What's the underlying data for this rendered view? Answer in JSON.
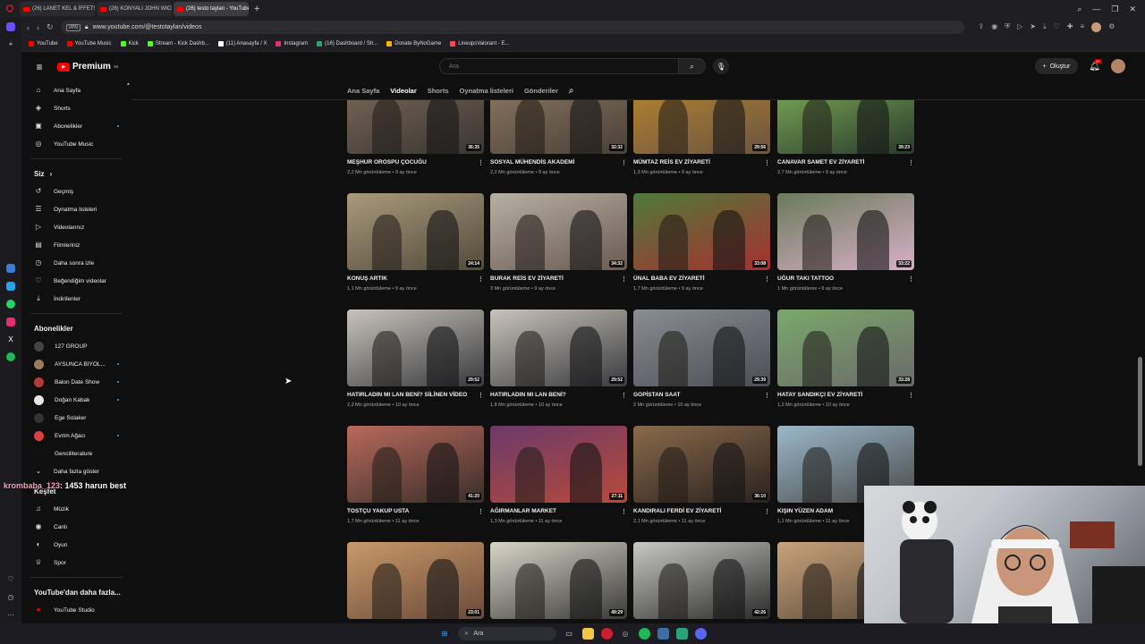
{
  "browser": {
    "tabs": [
      {
        "title": "(26) LANET KEL & İFFETSİZ",
        "active": false
      },
      {
        "title": "(26) KONYALI JOHN WICK",
        "active": false
      },
      {
        "title": "(26) testo taylan - YouTube",
        "active": true
      }
    ],
    "url": "www.youtube.com/@testotaylan/videos",
    "vpn_label": "VPN",
    "bookmarks": [
      {
        "label": "YouTube",
        "color": "#ff0000"
      },
      {
        "label": "YouTube Music",
        "color": "#ff0000"
      },
      {
        "label": "Kick",
        "color": "#53fc18"
      },
      {
        "label": "Stream - Kick Dashb...",
        "color": "#53fc18"
      },
      {
        "label": "(11) Anasayfa / X",
        "color": "#ffffff"
      },
      {
        "label": "Instagram",
        "color": "#e1306c"
      },
      {
        "label": "(16) Dashboard / Str...",
        "color": "#2e9f6b"
      },
      {
        "label": "Donate ByNoGame",
        "color": "#f2b705"
      },
      {
        "label": "LineupsValorant - E...",
        "color": "#ff4655"
      }
    ]
  },
  "header": {
    "logo_text": "Premium",
    "logo_sup": "TR",
    "search_placeholder": "Ara",
    "create_label": "Oluştur",
    "notification_badge": "9+"
  },
  "sidebar": {
    "main": [
      {
        "label": "Ana Sayfa",
        "icon": "home-icon",
        "glyph": "⌂"
      },
      {
        "label": "Shorts",
        "icon": "shorts-icon",
        "glyph": "◈"
      },
      {
        "label": "Abonelikler",
        "icon": "subscriptions-icon",
        "glyph": "▣",
        "dot": true
      },
      {
        "label": "YouTube Music",
        "icon": "music-icon",
        "glyph": "◎"
      }
    ],
    "you_header": "Siz",
    "you": [
      {
        "label": "Geçmiş",
        "icon": "history-icon",
        "glyph": "↺"
      },
      {
        "label": "Oynatma listeleri",
        "icon": "playlist-icon",
        "glyph": "☰"
      },
      {
        "label": "Videolarınız",
        "icon": "your-videos-icon",
        "glyph": "▷"
      },
      {
        "label": "Filmleriniz",
        "icon": "movies-icon",
        "glyph": "▤"
      },
      {
        "label": "Daha sonra izle",
        "icon": "watch-later-icon",
        "glyph": "◷"
      },
      {
        "label": "Beğendiğim videolar",
        "icon": "like-icon",
        "glyph": "♡"
      },
      {
        "label": "İndirilenler",
        "icon": "download-icon",
        "glyph": "⤓"
      }
    ],
    "subs_header": "Abonelikler",
    "subs": [
      {
        "label": "127 GROUP",
        "color": "#444444",
        "dot": false
      },
      {
        "label": "AYSUNCA BIYOL...",
        "color": "#9a7b5b",
        "dot": true
      },
      {
        "label": "Balon Date Show",
        "color": "#b43b3b",
        "dot": true
      },
      {
        "label": "Doğan Kabak",
        "color": "#e6e6e6",
        "dot": true
      },
      {
        "label": "Ege Solaker",
        "color": "#333333",
        "dot": false
      },
      {
        "label": "Evrim Ağacı",
        "color": "#d8433f",
        "dot": true
      },
      {
        "label": "Genciliterature",
        "color": "#111111",
        "dot": false
      }
    ],
    "show_more": "Daha fazla göster",
    "explore_header": "Keşfet",
    "explore": [
      {
        "label": "Müzik",
        "icon": "music-note-icon",
        "glyph": "♫"
      },
      {
        "label": "Canlı",
        "icon": "live-icon",
        "glyph": "◉"
      },
      {
        "label": "Oyun",
        "icon": "gaming-icon",
        "glyph": "◐"
      },
      {
        "label": "Spor",
        "icon": "trophy-icon",
        "glyph": "♕"
      }
    ],
    "more_header": "YouTube'dan daha fazla...",
    "studio": "YouTube Studio"
  },
  "channel_tabs": [
    "Ana Sayfa",
    "Videolar",
    "Shorts",
    "Oynatma listeleri",
    "Gönderiler"
  ],
  "active_tab": "Videolar",
  "videos": [
    {
      "title": "MEŞHUR OROSPU ÇOCUĞU",
      "views": "2,2 Mn görüntüleme",
      "age": "9 ay önce",
      "duration": "36:35",
      "c1": "#7b6a5a",
      "c2": "#3a3632"
    },
    {
      "title": "SOSYAL MÜHENDİS AKADEMİ",
      "views": "2,2 Mn görüntüleme",
      "age": "9 ay önce",
      "duration": "32:32",
      "c1": "#8d7a64",
      "c2": "#4a4036"
    },
    {
      "title": "MÜMTAZ REİS EV ZİYARETİ",
      "views": "1,3 Mn görüntüleme",
      "age": "9 ay önce",
      "duration": "29:56",
      "c1": "#b8862e",
      "c2": "#6b5540"
    },
    {
      "title": "CANAVAR SAMET EV ZİYARETİ",
      "views": "2,7 Mn görüntüleme",
      "age": "9 ay önce",
      "duration": "39:23",
      "c1": "#7fb05a",
      "c2": "#2a3a2a"
    },
    {
      "title": "KONUŞ ARTIK",
      "views": "1,1 Mn görüntüleme",
      "age": "9 ay önce",
      "duration": "24:14",
      "c1": "#a89a7a",
      "c2": "#524a3c"
    },
    {
      "title": "BURAK REİS EV ZİYARETİ",
      "views": "3 Mn görüntüleme",
      "age": "9 ay önce",
      "duration": "34:32",
      "c1": "#b6b0a4",
      "c2": "#6a5a52"
    },
    {
      "title": "ÜNAL BABA EV ZİYARETİ",
      "views": "1,7 Mn görüntüleme",
      "age": "9 ay önce",
      "duration": "33:08",
      "c1": "#4e7a3a",
      "c2": "#a83030"
    },
    {
      "title": "UĞUR TAKI TATTOO",
      "views": "1 Mn görüntüleme",
      "age": "9 ay önce",
      "duration": "33:22",
      "c1": "#6a7a5a",
      "c2": "#d8b0c8"
    },
    {
      "title": "HATIRLADIN MI LAN BENİ? SİLİNEN VİDEO",
      "views": "2,2 Mn görüntüleme",
      "age": "10 ay önce",
      "duration": "29:52",
      "c1": "#c8c4bc",
      "c2": "#3a3a3e"
    },
    {
      "title": "HATIRLADIN MI LAN BENİ?",
      "views": "1,8 Mn görüntüleme",
      "age": "10 ay önce",
      "duration": "29:52",
      "c1": "#c8c4bc",
      "c2": "#3a3a3e"
    },
    {
      "title": "GOPİSTAN SAAT",
      "views": "2 Mn görüntüleme",
      "age": "10 ay önce",
      "duration": "29:39",
      "c1": "#8a8e92",
      "c2": "#4a4e56"
    },
    {
      "title": "HATAY SANDIKÇI EV ZİYARETİ",
      "views": "1,2 Mn görüntüleme",
      "age": "10 ay önce",
      "duration": "33:28",
      "c1": "#7aa86a",
      "c2": "#6a6a6a"
    },
    {
      "title": "TOSTÇU YAKUP USTA",
      "views": "1,7 Mn görüntüleme",
      "age": "11 ay önce",
      "duration": "41:20",
      "c1": "#b86a5a",
      "c2": "#3a2e2a"
    },
    {
      "title": "AĞIRMANLAR MARKET",
      "views": "1,3 Mn görüntüleme",
      "age": "11 ay önce",
      "duration": "27:11",
      "c1": "#6a3a6a",
      "c2": "#b84a3a"
    },
    {
      "title": "KANDIRALI FERDİ EV ZİYARETİ",
      "views": "2,1 Mn görüntüleme",
      "age": "11 ay önce",
      "duration": "36:10",
      "c1": "#8a6a4a",
      "c2": "#2a2220"
    },
    {
      "title": "KIŞIN YÜZEN ADAM",
      "views": "1,1 Mn görüntüleme",
      "age": "11 ay önce",
      "duration": "",
      "c1": "#9ab8c8",
      "c2": "#4a4a4a"
    },
    {
      "title": "",
      "views": "",
      "age": "",
      "duration": "23:01",
      "c1": "#c89a6a",
      "c2": "#6a4a3a"
    },
    {
      "title": "",
      "views": "",
      "age": "",
      "duration": "49:29",
      "c1": "#d8d4c8",
      "c2": "#3a3a38"
    },
    {
      "title": "",
      "views": "",
      "age": "",
      "duration": "42:26",
      "c1": "#c8c8c4",
      "c2": "#2a2a2a"
    },
    {
      "title": "",
      "views": "",
      "age": "",
      "duration": "",
      "c1": "#c8a27a",
      "c2": "#5a4a3a"
    }
  ],
  "chat": {
    "user": "krombaba_123",
    "message": ": 1453 harun best"
  },
  "taskbar": {
    "search_label": "Ara"
  }
}
